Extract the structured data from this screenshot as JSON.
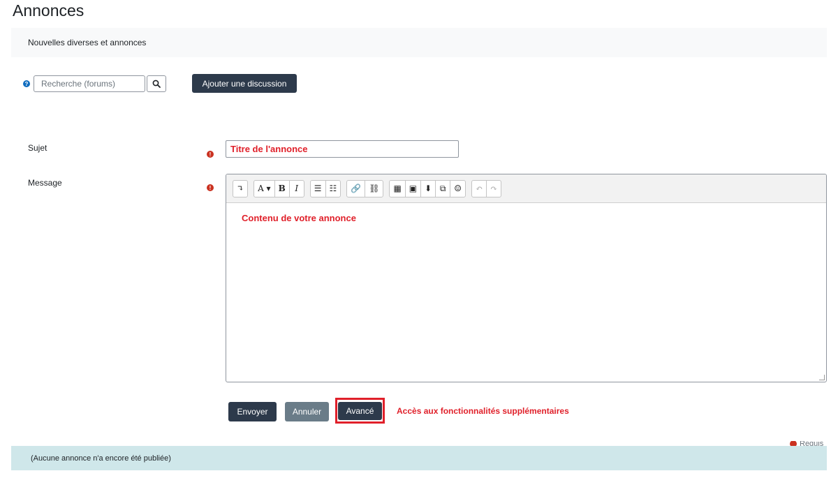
{
  "page": {
    "title": "Annonces"
  },
  "intro": {
    "text": "Nouvelles diverses et annonces"
  },
  "search": {
    "placeholder": "Recherche (forums)",
    "help_icon": "question-circle-icon",
    "search_icon": "magnifier-icon"
  },
  "actions": {
    "add_discussion": "Ajouter une discussion"
  },
  "form": {
    "subject_label": "Sujet",
    "subject_value": "Titre de l'annonce",
    "message_label": "Message",
    "message_content": "Contenu de votre annonce",
    "required_icon": "exclamation-circle-icon"
  },
  "toolbar": {
    "groups": [
      [
        "↴"
      ],
      [
        "A ▾",
        "B",
        "I"
      ],
      [
        "☰",
        "☷"
      ],
      [
        "🔗",
        "⛓"
      ],
      [
        "▦",
        "▣",
        "⬇",
        "⧉",
        "☺"
      ],
      [
        "↶",
        "↷"
      ]
    ]
  },
  "buttons": {
    "send": "Envoyer",
    "cancel": "Annuler",
    "advanced": "Avancé"
  },
  "annotation": {
    "advanced_note": "Accès aux fonctionnalités supplémentaires"
  },
  "legend": {
    "required": "Requis"
  },
  "notice": {
    "text": "(Aucune annonce n'a encore été publiée)"
  },
  "colors": {
    "primary_dark": "#2d3a4b",
    "secondary": "#6a7c88",
    "required": "#ca3120",
    "annotation_red": "#e0202a",
    "notice_bg": "#cfe7ea"
  }
}
